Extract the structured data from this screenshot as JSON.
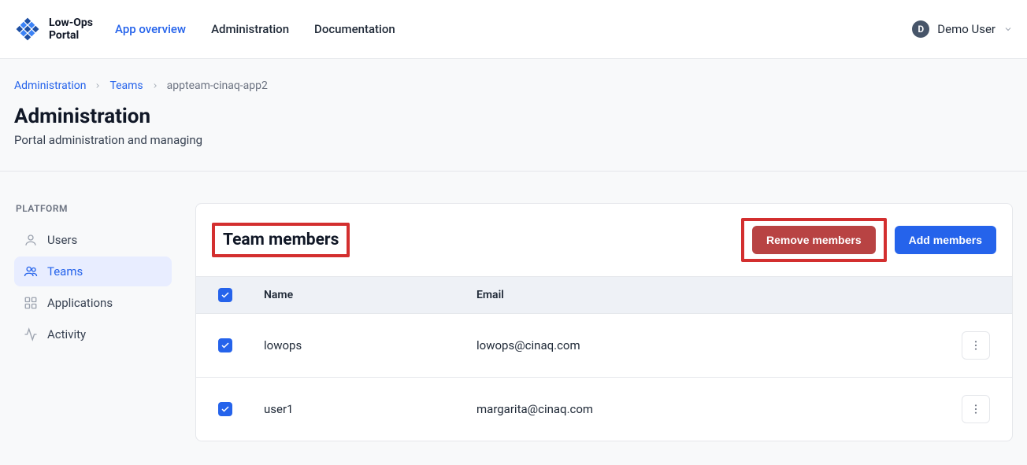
{
  "app": {
    "logo_line1": "Low-Ops",
    "logo_line2": "Portal"
  },
  "nav": {
    "items": [
      {
        "label": "App overview",
        "active": true
      },
      {
        "label": "Administration",
        "active": false
      },
      {
        "label": "Documentation",
        "active": false
      }
    ]
  },
  "user": {
    "initial": "D",
    "name": "Demo User"
  },
  "breadcrumb": {
    "items": [
      {
        "label": "Administration",
        "current": false
      },
      {
        "label": "Teams",
        "current": false
      },
      {
        "label": "appteam-cinaq-app2",
        "current": true
      }
    ]
  },
  "page": {
    "title": "Administration",
    "subtitle": "Portal administration and managing"
  },
  "sidebar": {
    "heading": "PLATFORM",
    "items": [
      {
        "label": "Users",
        "icon": "user-icon",
        "active": false
      },
      {
        "label": "Teams",
        "icon": "users-icon",
        "active": true
      },
      {
        "label": "Applications",
        "icon": "apps-icon",
        "active": false
      },
      {
        "label": "Activity",
        "icon": "activity-icon",
        "active": false
      }
    ]
  },
  "card": {
    "title": "Team members",
    "remove_label": "Remove members",
    "add_label": "Add members"
  },
  "table": {
    "header": {
      "name": "Name",
      "email": "Email"
    },
    "rows": [
      {
        "name": "lowops",
        "email": "lowops@cinaq.com",
        "checked": true
      },
      {
        "name": "user1",
        "email": "margarita@cinaq.com",
        "checked": true
      }
    ]
  }
}
